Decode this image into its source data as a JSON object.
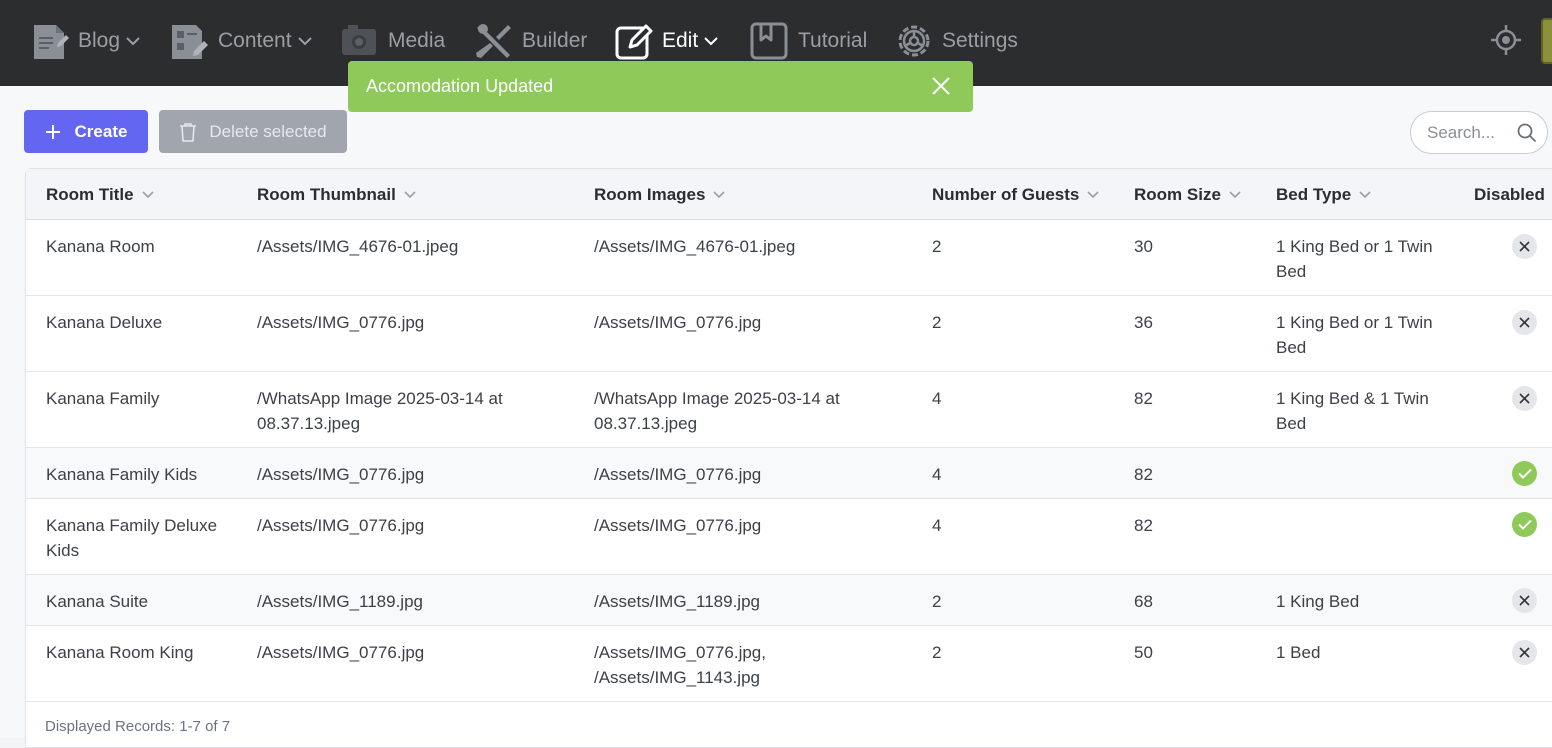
{
  "nav": {
    "items": [
      {
        "label": "Blog",
        "has_dropdown": true,
        "icon": "blog-document-icon"
      },
      {
        "label": "Content",
        "has_dropdown": true,
        "icon": "content-edit-icon"
      },
      {
        "label": "Media",
        "has_dropdown": false,
        "icon": "media-image-icon"
      },
      {
        "label": "Builder",
        "has_dropdown": false,
        "icon": "builder-tools-icon"
      },
      {
        "label": "Edit",
        "has_dropdown": true,
        "icon": "edit-pencil-icon",
        "active": true
      },
      {
        "label": "Tutorial",
        "has_dropdown": false,
        "icon": "tutorial-bookmark-icon"
      },
      {
        "label": "Settings",
        "has_dropdown": false,
        "icon": "settings-gear-icon"
      }
    ],
    "right_icon": "crosshair-icon"
  },
  "toast": {
    "message": "Accomodation Updated",
    "color": "#8fc95a"
  },
  "toolbar": {
    "create_label": "Create",
    "delete_label": "Delete selected",
    "search_placeholder": "Search..."
  },
  "table": {
    "columns": [
      "Room Title",
      "Room Thumbnail",
      "Room Images",
      "Number of Guests",
      "Room Size",
      "Bed Type",
      "Disabled"
    ],
    "rows": [
      {
        "title": "Kanana Room",
        "thumbnail": "/Assets/IMG_4676-01.jpeg",
        "images": "/Assets/IMG_4676-01.jpeg",
        "guests": "2",
        "size": "30",
        "bed": "1 King Bed or 1 Twin Bed",
        "disabled": false
      },
      {
        "title": "Kanana Deluxe",
        "thumbnail": "/Assets/IMG_0776.jpg",
        "images": "/Assets/IMG_0776.jpg",
        "guests": "2",
        "size": "36",
        "bed": "1 King Bed or 1 Twin Bed",
        "disabled": false
      },
      {
        "title": "Kanana Family",
        "thumbnail": "/WhatsApp Image 2025-03-14 at 08.37.13.jpeg",
        "images": "/WhatsApp Image 2025-03-14 at 08.37.13.jpeg",
        "guests": "4",
        "size": "82",
        "bed": "1 King Bed & 1 Twin Bed",
        "disabled": false
      },
      {
        "title": "Kanana Family Kids",
        "thumbnail": "/Assets/IMG_0776.jpg",
        "images": "/Assets/IMG_0776.jpg",
        "guests": "4",
        "size": "82",
        "bed": "",
        "disabled": true
      },
      {
        "title": "Kanana Family Deluxe Kids",
        "thumbnail": "/Assets/IMG_0776.jpg",
        "images": "/Assets/IMG_0776.jpg",
        "guests": "4",
        "size": "82",
        "bed": "",
        "disabled": true
      },
      {
        "title": "Kanana Suite",
        "thumbnail": "/Assets/IMG_1189.jpg",
        "images": "/Assets/IMG_1189.jpg",
        "guests": "2",
        "size": "68",
        "bed": "1 King Bed",
        "disabled": false
      },
      {
        "title": "Kanana Room King",
        "thumbnail": "/Assets/IMG_0776.jpg",
        "images": "/Assets/IMG_0776.jpg, /Assets/IMG_1143.jpg",
        "guests": "2",
        "size": "50",
        "bed": "1 Bed",
        "disabled": false
      }
    ]
  },
  "footer": {
    "records_text": "Displayed Records: 1-7 of 7"
  },
  "colors": {
    "accent": "#6366f1",
    "success": "#8fc95a",
    "nav_bg": "#2b2d2f"
  }
}
